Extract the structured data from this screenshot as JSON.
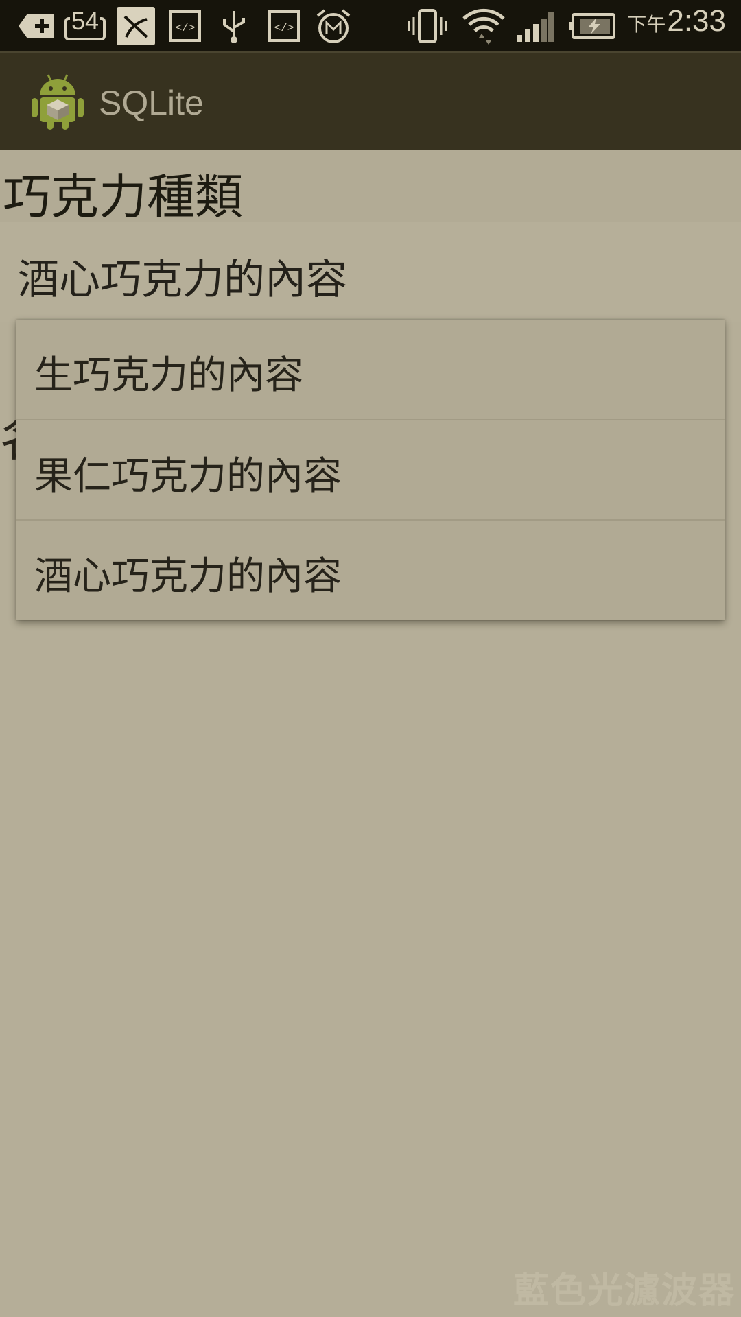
{
  "status_bar": {
    "notification_count": "54",
    "time_ampm": "下午",
    "time": "2:33",
    "icons": [
      "add-icon",
      "mail-count-icon",
      "no-disturb-icon",
      "code-icon",
      "usb-icon",
      "code-icon",
      "alarm-icon",
      "vibrate-icon",
      "wifi-icon",
      "signal-icon",
      "battery-charging-icon"
    ]
  },
  "action_bar": {
    "title": "SQLite",
    "icon": "android-icon"
  },
  "content": {
    "section_label": "巧克力種類",
    "spinner_selected": "酒心巧克力的內容",
    "partial_glyph": "名"
  },
  "dropdown": {
    "items": [
      {
        "label": "生巧克力的內容"
      },
      {
        "label": "果仁巧克力的內容"
      },
      {
        "label": "酒心巧克力的內容"
      }
    ]
  },
  "watermark": "藍色光濾波器",
  "colors": {
    "background": "#b5ae98",
    "status_bar": "#16140b",
    "action_bar": "#37321f",
    "text": "#1d1b11"
  }
}
